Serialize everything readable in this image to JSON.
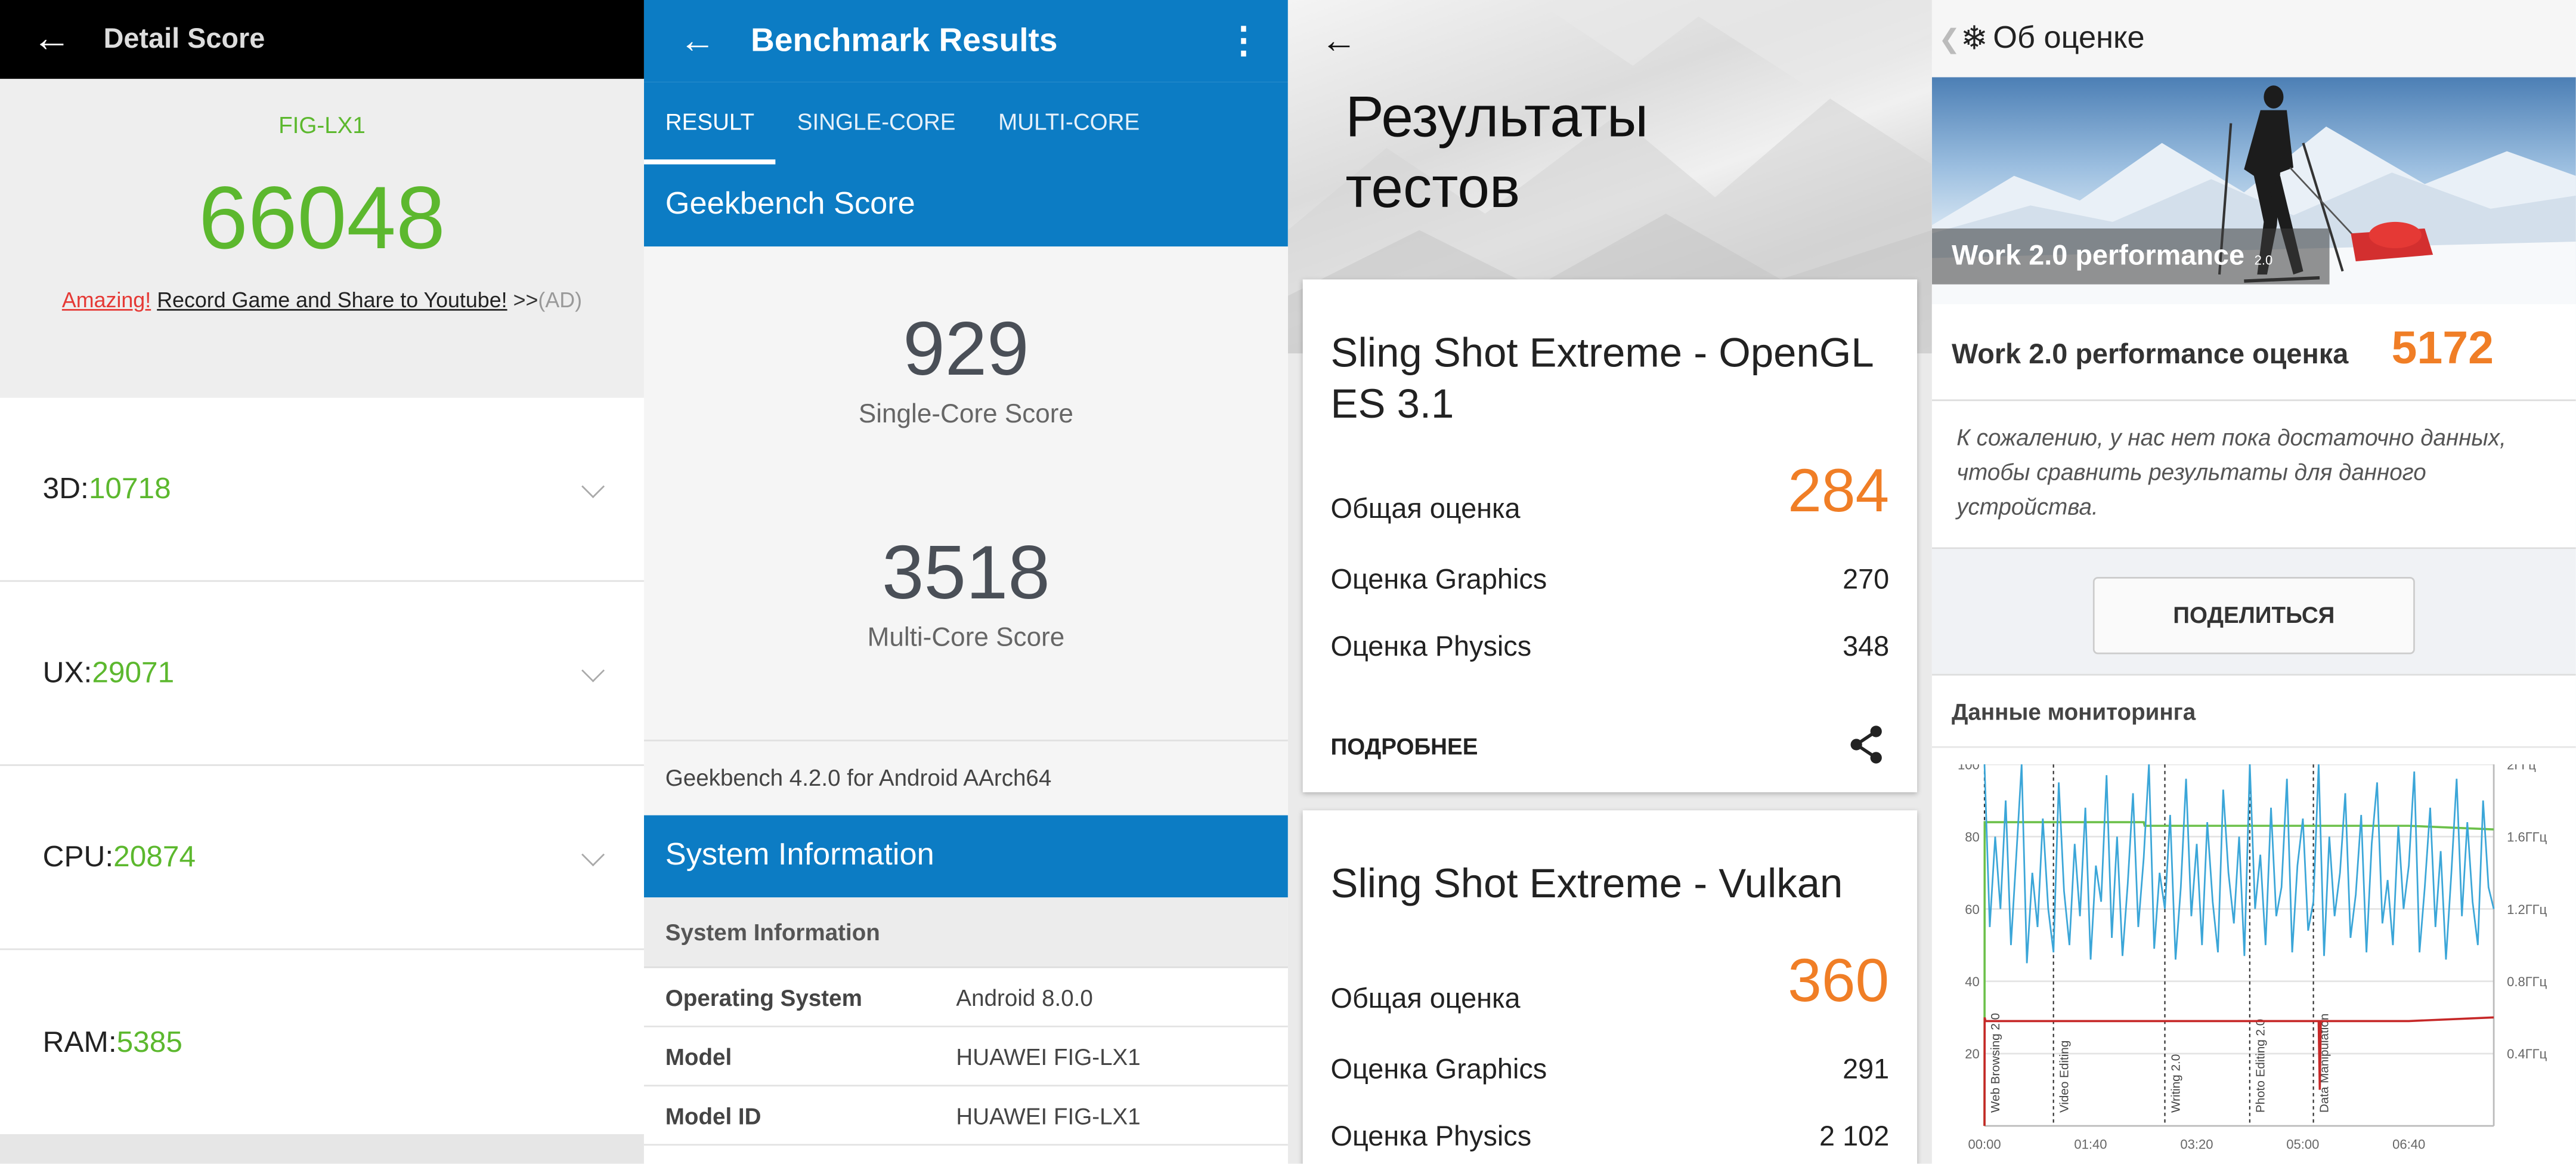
{
  "antutu": {
    "title": "Detail Score",
    "device": "FIG-LX1",
    "total": "66048",
    "promo_amazing": "Amazing!",
    "promo_link": "Record Game and Share to Youtube!",
    "promo_arrows": ">>",
    "promo_ad": "(AD)",
    "rows": [
      {
        "label": "3D: ",
        "value": "10718",
        "expandable": true
      },
      {
        "label": "UX: ",
        "value": "29071",
        "expandable": true
      },
      {
        "label": "CPU: ",
        "value": "20874",
        "expandable": true
      },
      {
        "label": "RAM: ",
        "value": "5385",
        "expandable": false
      }
    ]
  },
  "geekbench": {
    "title": "Benchmark Results",
    "tabs": [
      "RESULT",
      "SINGLE-CORE",
      "MULTI-CORE"
    ],
    "active_tab": "RESULT",
    "score_section": "Geekbench Score",
    "single_score": "929",
    "single_label": "Single-Core Score",
    "multi_score": "3518",
    "multi_label": "Multi-Core Score",
    "version": "Geekbench 4.2.0 for Android AArch64",
    "sysinfo_section": "System Information",
    "sysinfo_header": "System Information",
    "rows": [
      {
        "key": "Operating System",
        "value": "Android 8.0.0"
      },
      {
        "key": "Model",
        "value": "HUAWEI FIG-LX1"
      },
      {
        "key": "Model ID",
        "value": "HUAWEI FIG-LX1"
      }
    ],
    "accent": "#0c7cc4"
  },
  "threedmark": {
    "title_line1": "Результаты",
    "title_line2": "тестов",
    "cards": [
      {
        "title": "Sling Shot Extreme - OpenGL ES 3.1",
        "overall_label": "Общая оценка",
        "overall": "284",
        "graphics_label": "Оценка Graphics",
        "graphics": "270",
        "physics_label": "Оценка Physics",
        "physics": "348",
        "details": "ПОДРОБНЕЕ"
      },
      {
        "title": "Sling Shot Extreme - Vulkan",
        "overall_label": "Общая оценка",
        "overall": "360",
        "graphics_label": "Оценка Graphics",
        "graphics": "291",
        "physics_label": "Оценка Physics",
        "physics": "2 102"
      }
    ],
    "accent": "#f07e26"
  },
  "pcmark": {
    "title": "Об оценке",
    "banner_label": "Work 2.0 performance",
    "banner_small": "2.0",
    "score_label": "Work 2.0 performance оценка",
    "score": "5172",
    "note": "К сожалению, у нас нет пока достаточно данных, чтобы сравнить результаты для данного устройства.",
    "share_button": "ПОДЕЛИТЬСЯ",
    "monitoring_title": "Данные мониторинга",
    "chart_data": {
      "type": "line",
      "y_left_ticks": [
        "100",
        "80",
        "60",
        "40",
        "20"
      ],
      "y_right_ticks": [
        "2ГГц",
        "1.6ГГц",
        "1.2ГГц",
        "0.8ГГц",
        "0.4ГГц"
      ],
      "x_ticks": [
        "00:00",
        "01:40",
        "03:20",
        "05:00",
        "06:40"
      ],
      "sections": [
        "Web Browsing 2.0",
        "Video Editing",
        "Writing 2.0",
        "Photo Editing 2.0",
        "Data Manipulation"
      ],
      "ylim": [
        0,
        100
      ],
      "xlim": [
        0,
        480
      ],
      "series": [
        {
          "color": "#6cc04a",
          "x": [
            0,
            0.2,
            1,
            150,
            151,
            220,
            221,
            300,
            400,
            480
          ],
          "y": [
            0,
            84,
            84,
            84,
            83,
            83,
            83,
            83,
            83,
            82
          ]
        },
        {
          "color": "#c62828",
          "x": [
            0,
            0.2,
            1,
            100,
            200,
            300,
            315,
            316,
            317,
            400,
            480
          ],
          "y": [
            0,
            30,
            29,
            29,
            29,
            29,
            29,
            10,
            29,
            29,
            30
          ]
        },
        {
          "color": "#3ba6d8",
          "x": [
            0,
            5,
            10,
            15,
            20,
            25,
            30,
            35,
            40,
            45,
            50,
            55,
            60,
            65,
            70,
            75,
            80,
            85,
            90,
            95,
            100,
            105,
            110,
            115,
            120,
            125,
            130,
            135,
            140,
            145,
            150,
            155,
            160,
            165,
            170,
            175,
            180,
            185,
            190,
            195,
            200,
            205,
            210,
            215,
            220,
            225,
            230,
            235,
            240,
            245,
            250,
            255,
            260,
            265,
            270,
            275,
            280,
            285,
            290,
            295,
            300,
            305,
            310,
            315,
            320,
            325,
            330,
            335,
            340,
            345,
            350,
            355,
            360,
            365,
            370,
            375,
            380,
            385,
            390,
            395,
            400,
            405,
            410,
            415,
            420,
            425,
            430,
            435,
            440,
            445,
            450,
            455,
            460,
            465,
            470,
            475,
            480
          ],
          "y": [
            100,
            55,
            80,
            60,
            90,
            50,
            75,
            100,
            45,
            70,
            55,
            85,
            60,
            48,
            95,
            65,
            50,
            78,
            58,
            88,
            46,
            72,
            62,
            97,
            52,
            80,
            47,
            67,
            92,
            55,
            74,
            100,
            49,
            70,
            60,
            86,
            46,
            66,
            96,
            58,
            78,
            50,
            84,
            62,
            48,
            93,
            70,
            56,
            80,
            47,
            100,
            60,
            75,
            50,
            88,
            58,
            66,
            96,
            48,
            72,
            85,
            54,
            62,
            100,
            47,
            80,
            58,
            70,
            92,
            52,
            64,
            86,
            48,
            78,
            95,
            56,
            68,
            50,
            83,
            60,
            72,
            98,
            48,
            66,
            88,
            55,
            76,
            46,
            70,
            96,
            58,
            84,
            62,
            50,
            90,
            66,
            60
          ]
        }
      ]
    }
  }
}
